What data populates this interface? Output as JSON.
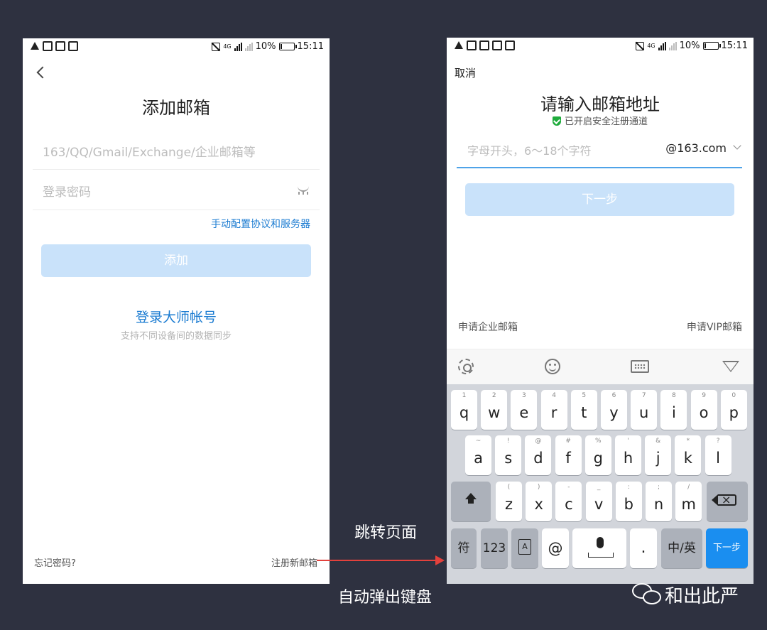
{
  "status_bar": {
    "network": "4G",
    "battery": "10%",
    "battery_level": 0.1,
    "time": "15:11"
  },
  "left_screen": {
    "title": "添加邮箱",
    "email_placeholder": "163/QQ/Gmail/Exchange/企业邮箱等",
    "password_placeholder": "登录密码",
    "manual_config_link": "手动配置协议和服务器",
    "add_button": "添加",
    "master_account_link": "登录大师帐号",
    "master_account_sub": "支持不同设备间的数据同步",
    "forgot_password": "忘记密码?",
    "register_link": "注册新邮箱"
  },
  "right_screen": {
    "cancel": "取消",
    "title": "请输入邮箱地址",
    "secure_note": "已开启安全注册通道",
    "input_placeholder": "字母开头，6～18个字符",
    "domain_select": "@163.com",
    "next_button": "下一步",
    "enterprise_link": "申请企业邮箱",
    "vip_link": "申请VIP邮箱",
    "keyboard": {
      "row1": [
        {
          "hint": "1",
          "ch": "q"
        },
        {
          "hint": "2",
          "ch": "w"
        },
        {
          "hint": "3",
          "ch": "e"
        },
        {
          "hint": "4",
          "ch": "r"
        },
        {
          "hint": "5",
          "ch": "t"
        },
        {
          "hint": "6",
          "ch": "y"
        },
        {
          "hint": "7",
          "ch": "u"
        },
        {
          "hint": "8",
          "ch": "i"
        },
        {
          "hint": "9",
          "ch": "o"
        },
        {
          "hint": "0",
          "ch": "p"
        }
      ],
      "row2": [
        {
          "hint": "~",
          "ch": "a"
        },
        {
          "hint": "!",
          "ch": "s"
        },
        {
          "hint": "@",
          "ch": "d"
        },
        {
          "hint": "#",
          "ch": "f"
        },
        {
          "hint": "%",
          "ch": "g"
        },
        {
          "hint": "'",
          "ch": "h"
        },
        {
          "hint": "&",
          "ch": "j"
        },
        {
          "hint": "*",
          "ch": "k"
        },
        {
          "hint": "?",
          "ch": "l"
        }
      ],
      "row3": [
        {
          "hint": "(",
          "ch": "z"
        },
        {
          "hint": ")",
          "ch": "x"
        },
        {
          "hint": "-",
          "ch": "c"
        },
        {
          "hint": "_",
          "ch": "v"
        },
        {
          "hint": ":",
          "ch": "b"
        },
        {
          "hint": ";",
          "ch": "n"
        },
        {
          "hint": "/",
          "ch": "m"
        }
      ],
      "symbol_key": "符",
      "num_key": "123",
      "lang_key_glyph": "A",
      "at_key": "@",
      "period_key": ".",
      "zh_en_key": "中/英",
      "enter_key": "下一步"
    }
  },
  "annotations": {
    "jump_page": "跳转页面",
    "auto_keyboard": "自动弹出键盘",
    "brand": "和出此严",
    "arrow_color": "#e3413c"
  },
  "colors": {
    "accent_blue": "#1a7bd1",
    "disabled_button": "#c9e2fa",
    "secure_green": "#1fab3c",
    "enter_key": "#1a8ef0"
  },
  "icons": [
    "back-chevron-icon",
    "eye-closed-icon",
    "shield-icon",
    "chevron-down-icon",
    "gear-icon",
    "smiley-icon",
    "keyboard-icon",
    "hide-keyboard-icon",
    "shift-icon",
    "backspace-icon",
    "mic-icon",
    "wechat-icon"
  ]
}
